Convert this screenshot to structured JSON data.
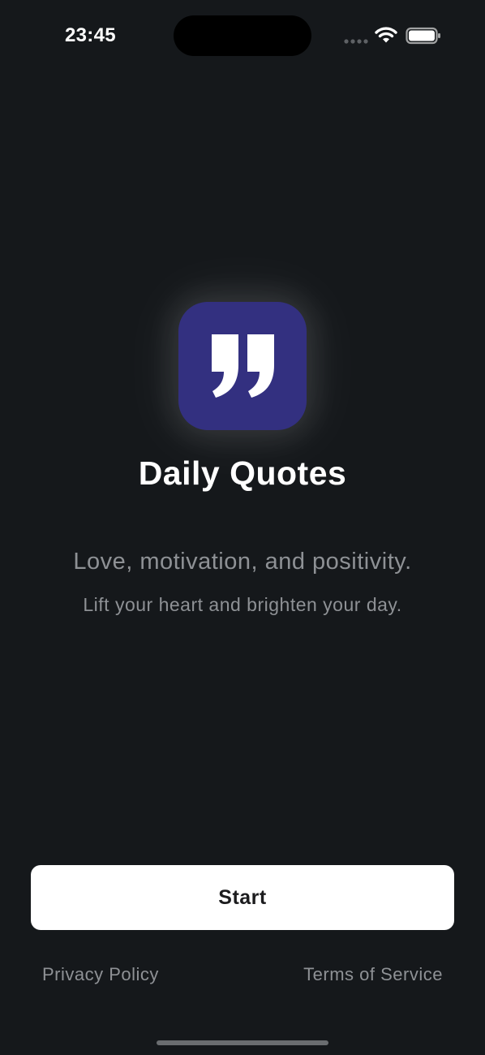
{
  "status_bar": {
    "time": "23:45",
    "signal_icon": "cellular-signal-dots",
    "wifi_icon": "wifi-icon",
    "battery_icon": "battery-full-icon"
  },
  "app": {
    "icon": "quote-marks-icon",
    "icon_color": "#333080",
    "title": "Daily Quotes",
    "tagline": "Love, motivation, and positivity.",
    "subtagline": "Lift your heart and brighten your day."
  },
  "actions": {
    "start_label": "Start"
  },
  "footer": {
    "privacy_label": "Privacy Policy",
    "terms_label": "Terms of Service"
  },
  "colors": {
    "background": "#15181b",
    "text_primary": "#ffffff",
    "text_secondary": "#8e9195",
    "button_bg": "#ffffff"
  }
}
